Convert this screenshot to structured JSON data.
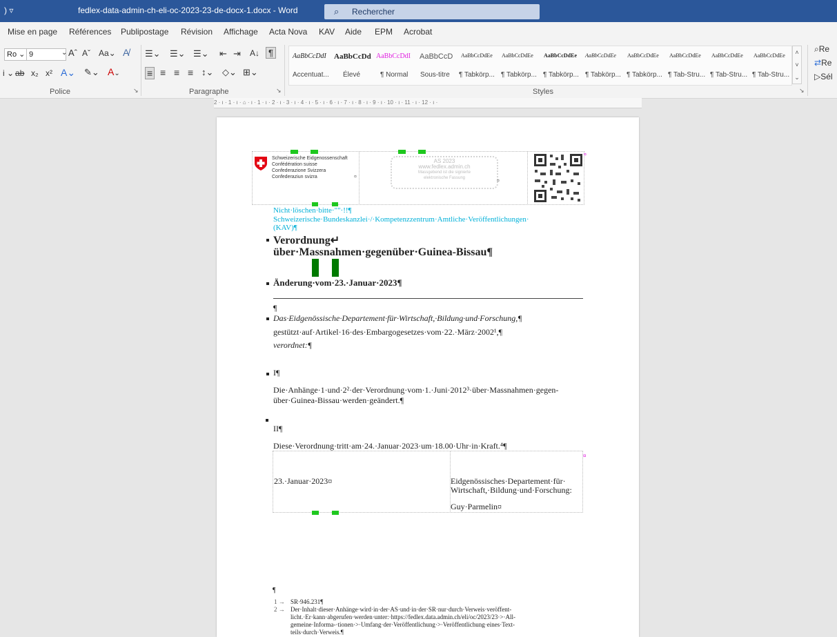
{
  "titlebar": {
    "quick_access": ") ▿",
    "document_title": "fedlex-data-admin-ch-eli-oc-2023-23-de-docx-1.docx  -  Word",
    "search_placeholder": "Rechercher"
  },
  "menu": {
    "items": [
      "Mise en page",
      "Références",
      "Publipostage",
      "Révision",
      "Affichage",
      "Acta Nova",
      "KAV",
      "Aide",
      "EPM",
      "Acrobat"
    ]
  },
  "ribbon": {
    "font": {
      "name": "Ro",
      "size": "9",
      "group_label": "Police"
    },
    "paragraph": {
      "group_label": "Paragraphe"
    },
    "styles": {
      "group_label": "Styles",
      "items": [
        {
          "sample": "AaBbCcDdI",
          "name": "Accentuat..."
        },
        {
          "sample": "AaBbCcDd",
          "name": "Élevé"
        },
        {
          "sample": "AaBbCcDdI",
          "name": "¶ Normal"
        },
        {
          "sample": "AaBbCcD",
          "name": "Sous-titre"
        },
        {
          "sample": "AaBbCcDdEe",
          "name": "¶ Tabkörp..."
        },
        {
          "sample": "AaBbCcDdEe",
          "name": "¶ Tabkörp..."
        },
        {
          "sample": "AaBbCcDdEe",
          "name": "¶ Tabkörp..."
        },
        {
          "sample": "AaBbCcDdEe",
          "name": "¶ Tabkörp..."
        },
        {
          "sample": "AaBbCcDdEe",
          "name": "¶ Tabkörp..."
        },
        {
          "sample": "AaBbCcDdEe",
          "name": "¶ Tab-Stru..."
        },
        {
          "sample": "AaBbCcDdEe",
          "name": "¶ Tab-Stru..."
        },
        {
          "sample": "AaBbCcDdEe",
          "name": "¶ Tab-Stru..."
        }
      ]
    },
    "editing": {
      "find": "Re",
      "replace": "Re",
      "select": "Sél"
    }
  },
  "ruler": {
    "text": "2 · ı · 1 · ı · ⌂ · ı · 1 · ı · 2 · ı · 3 · ı · 4 · ı · 5 · ı · 6 · ı · 7 · ı · 8 · ı · 9 · ı · 10 · ı · 11 · ı · 12 · ı ·"
  },
  "document": {
    "header": {
      "confed": [
        "Schweizerische Eidgenossenschaft",
        "Confédération suisse",
        "Confederazione Svizzera",
        "Confederaziun svizra"
      ],
      "as_box": [
        "AS 2023",
        "www.fedlex.admin.ch",
        "Massgebend ist die signierte",
        "elektronische Fassung"
      ]
    },
    "notice_line1": "Nicht·löschen·bitte·\"\"·!!¶",
    "notice_line2": "Schweizerische·Bundeskanzlei·/·Kompetenzzentrum·Amtliche·Veröffentlichungen·",
    "notice_line3": "(KAV)¶",
    "title_line1": "Verordnung↵",
    "title_line2": "über·Massnahmen·gegenüber·Guinea-Bissau¶",
    "change": "Änderung·vom·23.·Januar·2023¶",
    "empty_para": "¶",
    "department": "Das·Eidgenössische·Departement·für·Wirtschaft,·Bildung·und·Forschung,¶",
    "legal_basis": "gestützt·auf·Artikel·16·des·Embargogesetzes·vom·22.·März·2002¹,¶",
    "ordains": "verordnet:¶",
    "section_i": "I¶",
    "annex_line1": "Die·Anhänge·1·und·2²·der·Verordnung·vom·1.·Juni·2012³·über·Massnahmen·gegen-",
    "annex_line2": "über·Guinea-Bissau·werden·geändert.¶",
    "section_ii": "II¶",
    "entry_into_force": "Diese·Verordnung·tritt·am·24.·Januar·2023·um·18.00·Uhr·in·Kraft.⁴¶",
    "date_cell": "23.·Januar·2023¤",
    "dept_cell_line1": "Eidgenössisches·Departement·für·",
    "dept_cell_line2": "Wirtschaft,·Bildung·und·Forschung:",
    "signatory": "Guy·Parmelin¤",
    "footnote_para": "¶",
    "fn1_mark": "1 →",
    "fn1_text": "SR·946.231¶",
    "fn2_mark": "2 →",
    "fn2_line1": "Der·Inhalt·dieser·Anhänge·wird·in·der·AS·und·in·der·SR·nur·durch·Verweis·veröffent-",
    "fn2_line2": "licht.·Er·kann·abgerufen·werden·unter:·https://fedlex.data.admin.ch/eli/oc/2023/23·>·All-",
    "fn2_line3": "gemeine·Informa-·tionen·>·Umfang·der·Veröffentlichung·>·Veröffentlichung·eines·Text-",
    "fn2_line4": "teils·durch·Verweis.¶"
  }
}
